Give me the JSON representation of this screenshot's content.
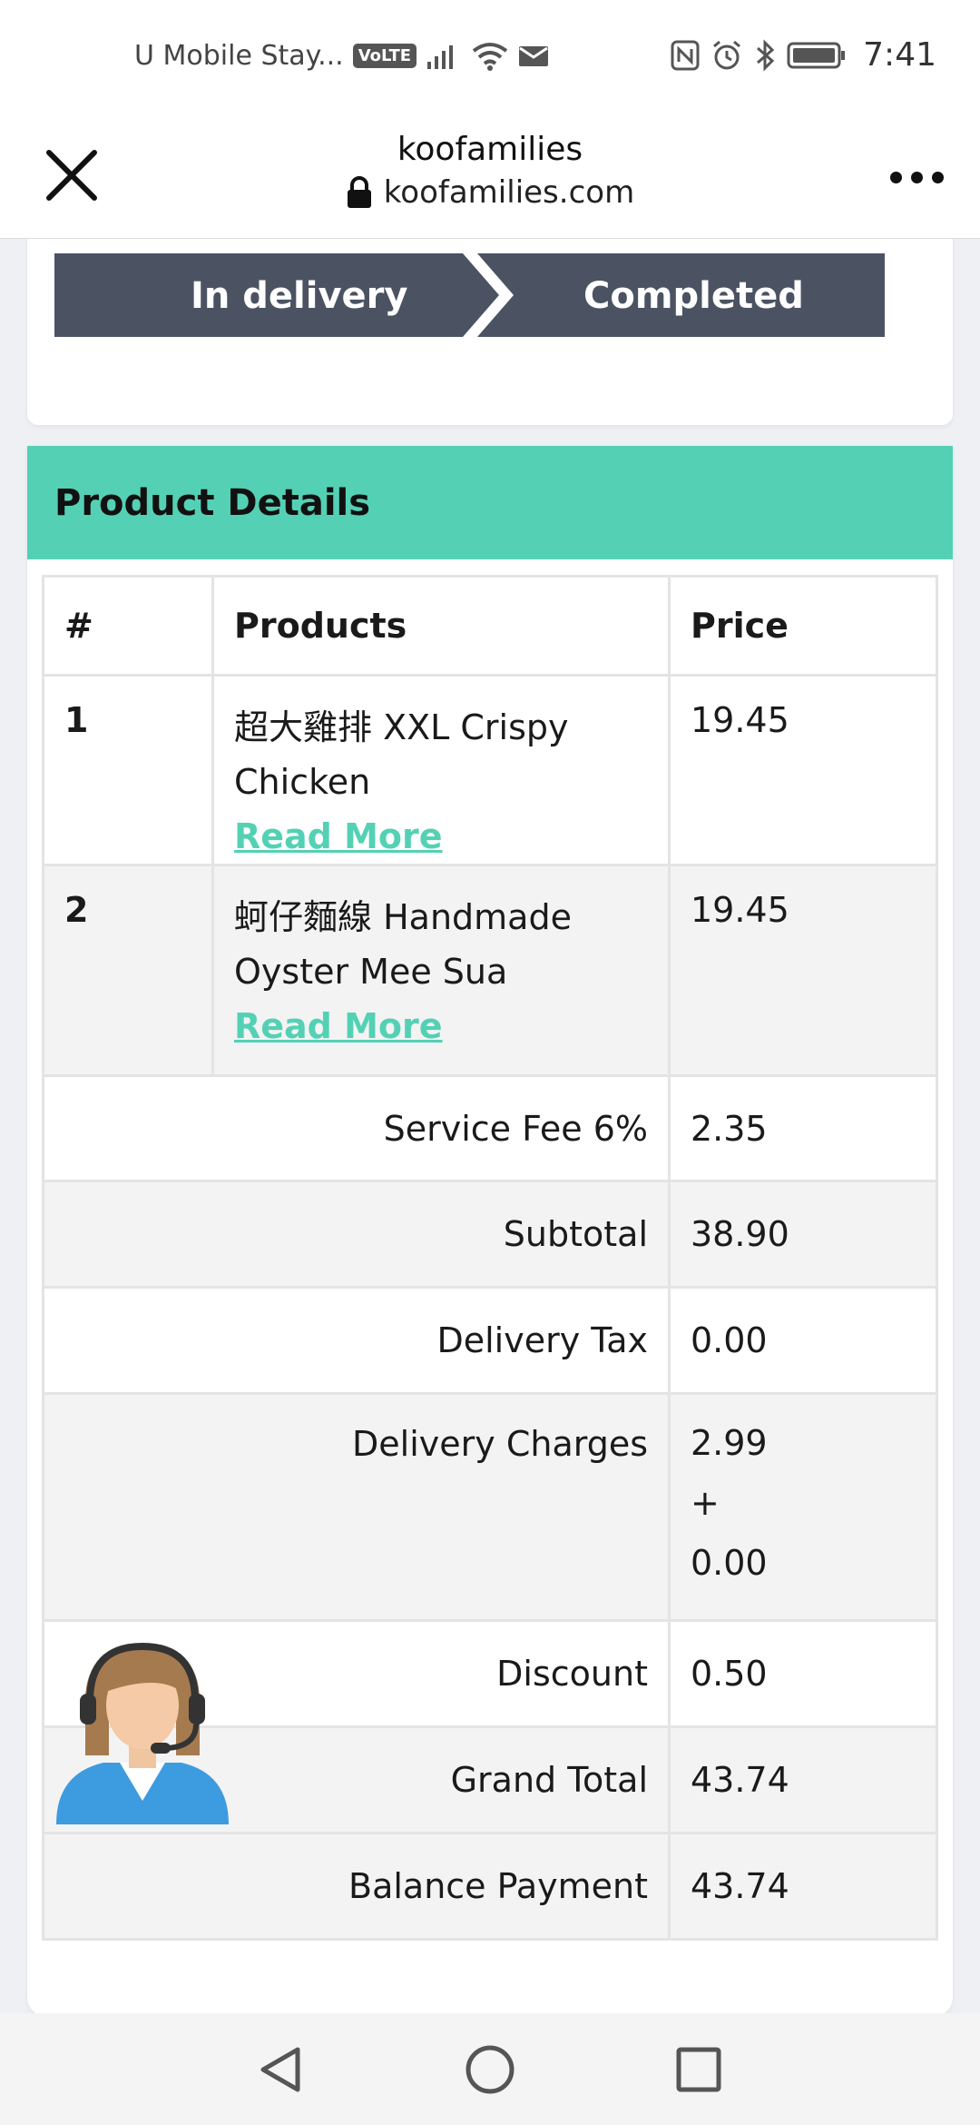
{
  "status_bar": {
    "carrier": "U Mobile Stay...",
    "volte": "VoLTE",
    "time": "7:41"
  },
  "browser": {
    "title": "koofamilies",
    "url": "koofamilies.com"
  },
  "order_steps": {
    "in_delivery": "In delivery",
    "completed": "Completed",
    "active_color": "#54d1b4",
    "inactive_color": "#4b5363"
  },
  "product_details": {
    "heading": "Product Details",
    "columns": [
      "#",
      "Products",
      "Price"
    ],
    "items": [
      {
        "index": "1",
        "name": "超大雞排 XXL Crispy Chicken",
        "read_more": "Read More",
        "price": "19.45"
      },
      {
        "index": "2",
        "name": "蚵仔麵線 Handmade Oyster Mee Sua",
        "read_more": "Read More",
        "price": "19.45"
      }
    ],
    "summary": {
      "service_fee_label": "Service Fee 6%",
      "service_fee_value": "2.35",
      "subtotal_label": "Subtotal",
      "subtotal_value": "38.90",
      "delivery_tax_label": "Delivery Tax",
      "delivery_tax_value": "0.00",
      "delivery_charges_label": "Delivery Charges",
      "delivery_charges_value_1": "2.99",
      "delivery_charges_plus": "+",
      "delivery_charges_value_2": "0.00",
      "discount_label": "Discount",
      "discount_value": "0.50",
      "grand_total_label": "Grand Total",
      "grand_total_value": "43.74",
      "balance_label": "Balance Payment",
      "balance_value": "43.74"
    }
  },
  "colors": {
    "accent": "#54d1b4"
  }
}
